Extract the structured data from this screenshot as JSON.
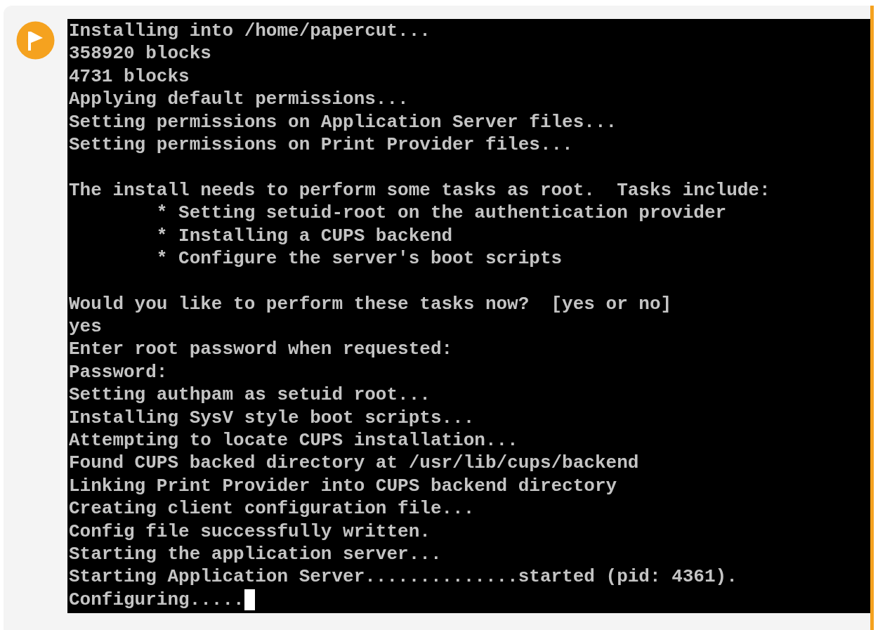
{
  "terminal": {
    "lines": [
      {
        "kind": "text",
        "text": "Installing into /home/papercut..."
      },
      {
        "kind": "text",
        "text": "358920 blocks"
      },
      {
        "kind": "text",
        "text": "4731 blocks"
      },
      {
        "kind": "text",
        "text": "Applying default permissions..."
      },
      {
        "kind": "text",
        "text": "Setting permissions on Application Server files..."
      },
      {
        "kind": "text",
        "text": "Setting permissions on Print Provider files..."
      },
      {
        "kind": "blank"
      },
      {
        "kind": "text",
        "text": "The install needs to perform some tasks as root.  Tasks include:"
      },
      {
        "kind": "text",
        "text": "        * Setting setuid-root on the authentication provider"
      },
      {
        "kind": "text",
        "text": "        * Installing a CUPS backend"
      },
      {
        "kind": "text",
        "text": "        * Configure the server's boot scripts"
      },
      {
        "kind": "blank"
      },
      {
        "kind": "text",
        "text": "Would you like to perform these tasks now?  [yes or no]"
      },
      {
        "kind": "text",
        "text": "yes"
      },
      {
        "kind": "text",
        "text": "Enter root password when requested:"
      },
      {
        "kind": "text",
        "text": "Password:"
      },
      {
        "kind": "text",
        "text": "Setting authpam as setuid root..."
      },
      {
        "kind": "text",
        "text": "Installing SysV style boot scripts..."
      },
      {
        "kind": "text",
        "text": "Attempting to locate CUPS installation..."
      },
      {
        "kind": "text",
        "text": "Found CUPS backed directory at /usr/lib/cups/backend"
      },
      {
        "kind": "text",
        "text": "Linking Print Provider into CUPS backend directory"
      },
      {
        "kind": "text",
        "text": "Creating client configuration file..."
      },
      {
        "kind": "text",
        "text": "Config file successfully written."
      },
      {
        "kind": "text",
        "text": "Starting the application server..."
      },
      {
        "kind": "text",
        "text": "Starting Application Server..............started (pid: 4361)."
      },
      {
        "kind": "text",
        "text": "Configuring....."
      }
    ],
    "cursor": true
  }
}
